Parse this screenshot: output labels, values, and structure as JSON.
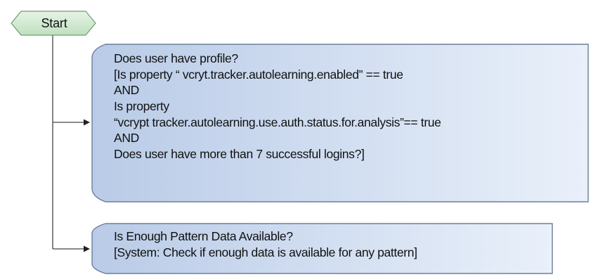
{
  "start": {
    "label": "Start"
  },
  "condition_1": {
    "lines": [
      "Does user have profile?",
      "[Is property “ vcryt.tracker.autolearning.enabled” == true",
      "AND",
      "Is property",
      "“vcrypt tracker.autolearning.use.auth.status.for.analysis”== true",
      "AND",
      "Does user have more than 7 successful logins?]"
    ]
  },
  "condition_2": {
    "lines": [
      "Is Enough Pattern Data Available?",
      "[System: Check if enough data is available for any pattern]"
    ]
  },
  "colors": {
    "start_fill": "#cfe8cf",
    "start_stroke": "#6f9b6f",
    "box_fill_light": "#e6eef9",
    "box_fill_dark": "#b7c9e6",
    "box_stroke": "#6c7f99",
    "connector": "#444444"
  }
}
